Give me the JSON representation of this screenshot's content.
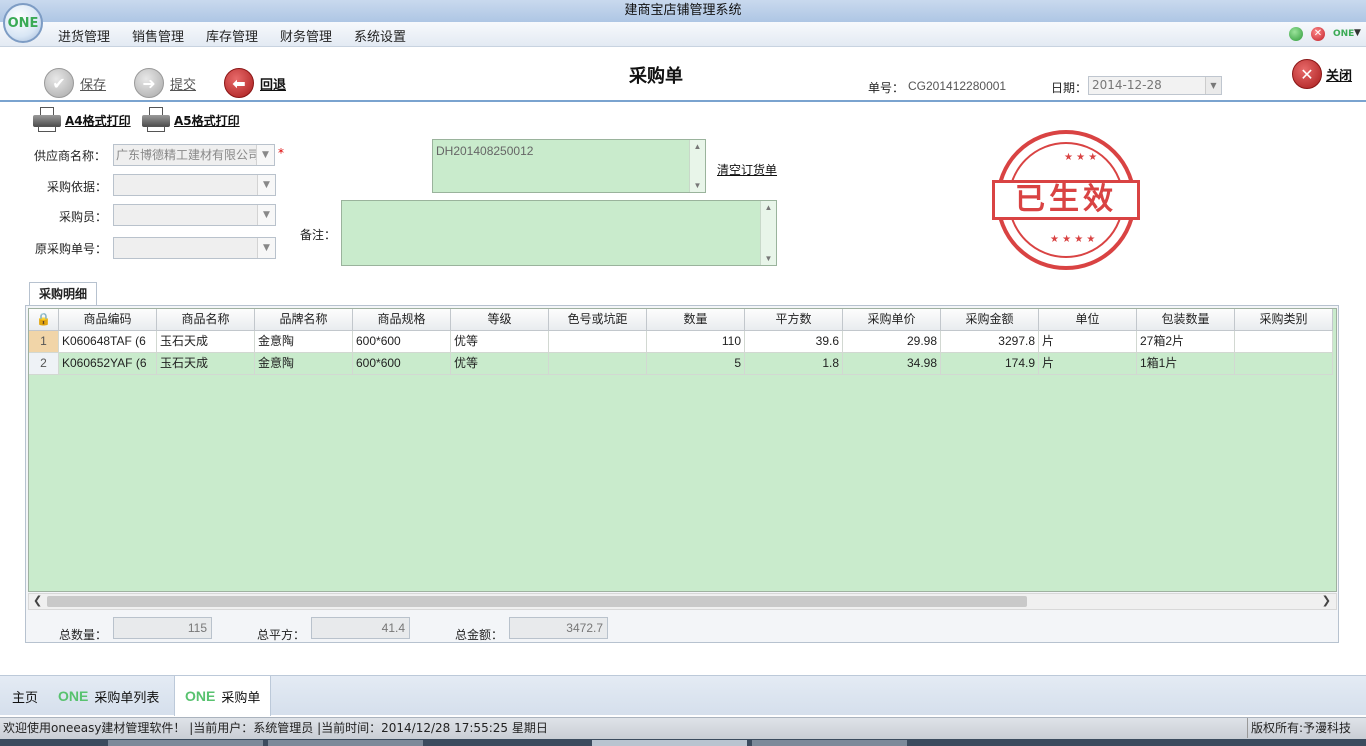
{
  "app": {
    "title": "建商宝店铺管理系统",
    "logo_text": "ONE"
  },
  "menu": [
    "进货管理",
    "销售管理",
    "库存管理",
    "财务管理",
    "系统设置"
  ],
  "window": {
    "one_label": "ONE"
  },
  "toolbar": {
    "save_label": "保存",
    "submit_label": "提交",
    "back_label": "回退",
    "page_title": "采购单",
    "order_no_label": "单号：",
    "order_no_value": "CG201412280001",
    "date_label": "日期：",
    "date_value": "2014-12-28",
    "close_label": "关闭"
  },
  "print": {
    "a4_label": "A4格式打印",
    "a5_label": "A5格式打印"
  },
  "form": {
    "supplier_label": "供应商名称：",
    "supplier_value": "广东博德精工建材有限公司",
    "required_mark": "*",
    "basis_label": "采购依据：",
    "basis_value": "",
    "buyer_label": "采购员：",
    "buyer_value": "",
    "orig_order_label": "原采购单号：",
    "orig_order_value": "",
    "order_ref_value": "DH201408250012",
    "clear_order_label": "清空订货单",
    "remark_label": "备注：",
    "remark_value": ""
  },
  "stamp": {
    "text": "已生效"
  },
  "details": {
    "tab_label": "采购明细",
    "columns": [
      "商品编码",
      "商品名称",
      "品牌名称",
      "商品规格",
      "等级",
      "色号或坑距",
      "数量",
      "平方数",
      "采购单价",
      "采购金额",
      "单位",
      "包装数量",
      "采购类别"
    ],
    "rows": [
      {
        "idx": "1",
        "code": "K060648TAF (6",
        "name": "玉石天成",
        "brand": "金意陶",
        "spec": "600*600",
        "grade": "优等",
        "color": "",
        "qty": "110",
        "area": "39.6",
        "price": "29.98",
        "amount": "3297.8",
        "unit": "片",
        "pack": "27箱2片",
        "category": ""
      },
      {
        "idx": "2",
        "code": "K060652YAF (6",
        "name": "玉石天成",
        "brand": "金意陶",
        "spec": "600*600",
        "grade": "优等",
        "color": "",
        "qty": "5",
        "area": "1.8",
        "price": "34.98",
        "amount": "174.9",
        "unit": "片",
        "pack": "1箱1片",
        "category": ""
      }
    ],
    "totals": {
      "qty_label": "总数量：",
      "qty_value": "115",
      "area_label": "总平方：",
      "area_value": "41.4",
      "amount_label": "总金额：",
      "amount_value": "3472.7"
    }
  },
  "bottom_tabs": [
    {
      "label": "主页",
      "logo": ""
    },
    {
      "label": "采购单列表",
      "logo": "ONE"
    },
    {
      "label": "采购单",
      "logo": "ONE"
    }
  ],
  "status": {
    "text": "欢迎使用oneeasy建材管理软件！  |当前用户：系统管理员  |当前时间：2014/12/28 17:55:25  星期日",
    "right": "版权所有:予漫科技"
  },
  "colors": {
    "accent_blue": "#7aa3cf",
    "grid_green": "#c9ebcc",
    "stamp_red": "#d42a2a"
  },
  "icons": [
    "save-check-icon",
    "submit-arrow-icon",
    "back-arrow-icon",
    "close-x-icon",
    "printer-icon",
    "lock-icon"
  ]
}
